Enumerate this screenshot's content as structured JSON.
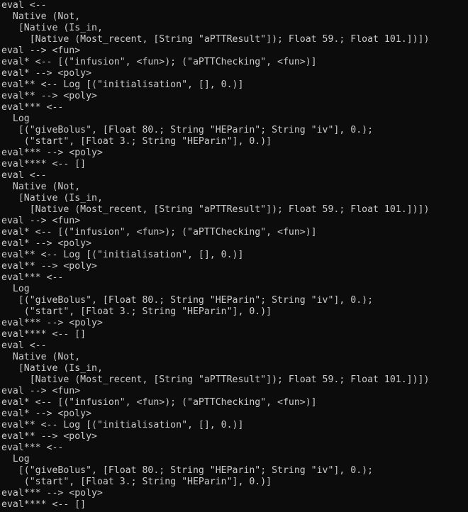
{
  "terminal": {
    "lines": [
      "eval <--",
      "  Native (Not,",
      "   [Native (Is_in,",
      "     [Native (Most_recent, [String \"aPTTResult\"]); Float 59.; Float 101.])])",
      "eval --> <fun>",
      "eval* <-- [(\"infusion\", <fun>); (\"aPTTChecking\", <fun>)]",
      "eval* --> <poly>",
      "eval** <-- Log [(\"initialisation\", [], 0.)]",
      "eval** --> <poly>",
      "eval*** <--",
      "  Log",
      "   [(\"giveBolus\", [Float 80.; String \"HEParin\"; String \"iv\"], 0.);",
      "    (\"start\", [Float 3.; String \"HEParin\"], 0.)]",
      "eval*** --> <poly>",
      "eval**** <-- []",
      "eval <--",
      "  Native (Not,",
      "   [Native (Is_in,",
      "     [Native (Most_recent, [String \"aPTTResult\"]); Float 59.; Float 101.])])",
      "eval --> <fun>",
      "eval* <-- [(\"infusion\", <fun>); (\"aPTTChecking\", <fun>)]",
      "eval* --> <poly>",
      "eval** <-- Log [(\"initialisation\", [], 0.)]",
      "eval** --> <poly>",
      "eval*** <--",
      "  Log",
      "   [(\"giveBolus\", [Float 80.; String \"HEParin\"; String \"iv\"], 0.);",
      "    (\"start\", [Float 3.; String \"HEParin\"], 0.)]",
      "eval*** --> <poly>",
      "eval**** <-- []",
      "eval <--",
      "  Native (Not,",
      "   [Native (Is_in,",
      "     [Native (Most_recent, [String \"aPTTResult\"]); Float 59.; Float 101.])])",
      "eval --> <fun>",
      "eval* <-- [(\"infusion\", <fun>); (\"aPTTChecking\", <fun>)]",
      "eval* --> <poly>",
      "eval** <-- Log [(\"initialisation\", [], 0.)]",
      "eval** --> <poly>",
      "eval*** <--",
      "  Log",
      "   [(\"giveBolus\", [Float 80.; String \"HEParin\"; String \"iv\"], 0.);",
      "    (\"start\", [Float 3.; String \"HEParin\"], 0.)]",
      "eval*** --> <poly>",
      "eval**** <-- []"
    ]
  },
  "colors": {
    "background": "#0c0c0c",
    "text": "#cccccc"
  }
}
